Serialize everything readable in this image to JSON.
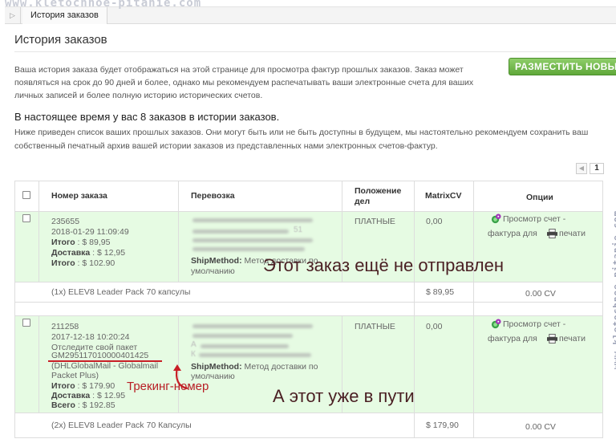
{
  "watermark": "www.kletochnoe-pitanie.com",
  "tab": {
    "label": "История заказов"
  },
  "page": {
    "title": "История заказов",
    "intro": "Ваша история заказа будет отображаться на этой странице для просмотра фактур прошлых заказов. Заказ может появляться на срок до 90 дней и более, однако мы рекомендуем распечатывать ваши электронные счета для ваших личных записей и более полную историю исторических счетов.",
    "new_button": "РАЗМЕСТИТЬ НОВЫЙ",
    "count_text": "В настоящее время у вас 8 заказов в истории заказов.",
    "notice": "Ниже приведен список ваших прошлых заказов. Они могут быть или не быть доступны в будущем, мы настоятельно рекомендуем сохранить ваш собственный печатный архив вашей истории заказов из представленных нами электронных счетов-фактур.",
    "page_number": "1"
  },
  "columns": {
    "order": "Номер заказа",
    "shipping": "Перевозка",
    "status_l1": "Положение",
    "status_l2": "дел",
    "cv": "MatrixCV",
    "options": "Опции"
  },
  "orders": [
    {
      "id": "235655",
      "date": "2018-01-29 11:09:49",
      "total_label": "Итого",
      "total": " : $ 89,95",
      "ship_label": "Доставка",
      "ship": " : $ 12,95",
      "grand_label": "Итого",
      "grand": " : $ 102.90",
      "ship_method_label": "ShipMethod:",
      "ship_method": " Метод доставки по",
      "ship_method_2": "умолчанию",
      "status": "ПЛАТНЫЕ",
      "cv": "0,00",
      "view_label": "Просмотр счет -",
      "view_label_2": "фактура для",
      "print_label": "печати",
      "item": "(1x) ELEV8 Leader Pack 70 капсулы",
      "item_price": "$ 89,95",
      "item_cv": "0.00 CV",
      "blur_snippet_1": "51",
      "annotation": "Этот заказ ещё не отправлен"
    },
    {
      "id": "211258",
      "date": "2017-12-18 10:20:24",
      "track_label": "Отследите свой пакет",
      "tracking": "GM295117010000401425",
      "carrier": "(DHLGlobalMail - Globalmail",
      "carrier_2": "Packet Plus)",
      "total_label": "Итого",
      "total": " : $ 179.90",
      "ship_label": "Доставка",
      "ship": " : $ 12.95",
      "grand_label": "Всего",
      "grand": " : $ 192.85",
      "ship_method_label": "ShipMethod:",
      "ship_method": " Метод доставки по",
      "ship_method_2": "умолчанию",
      "status": "ПЛАТНЫЕ",
      "cv": "0,00",
      "view_label": "Просмотр счет -",
      "view_label_2": "фактура для",
      "print_label": "печати",
      "item": "(2x) ELEV8 Leader Pack 70 Капсулы",
      "item_price": "$ 179,90",
      "item_cv": "0.00 CV",
      "blur_snippet_1": "А",
      "blur_snippet_2": "К",
      "tracking_annotation": "Трекинг-номер",
      "annotation": "А этот уже в пути"
    }
  ],
  "colors": {
    "row_green": "#e6fbe3",
    "button_green": "#5fa83a",
    "annotation_red": "#c81e26",
    "annotation_text": "#4a1f23"
  }
}
